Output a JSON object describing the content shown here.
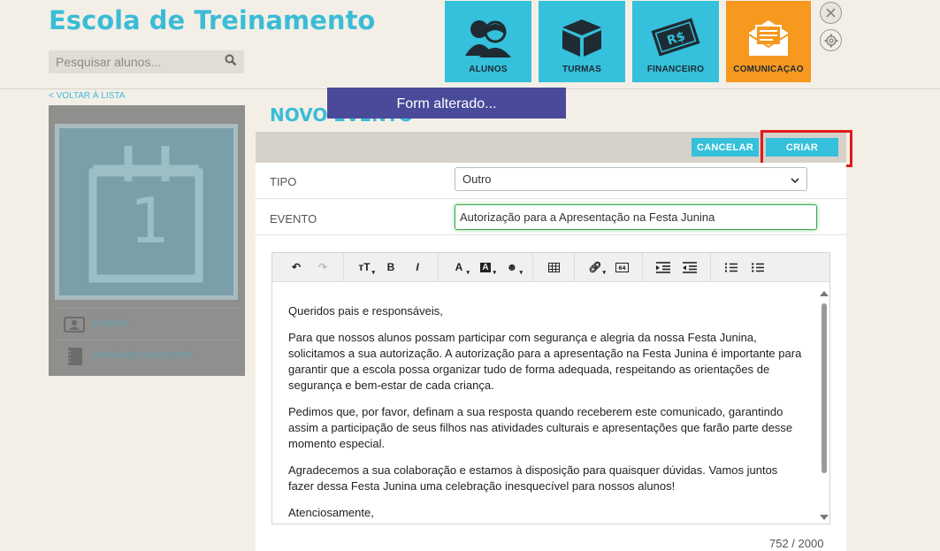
{
  "app": {
    "title": "Escola de Treinamento"
  },
  "search": {
    "placeholder": "Pesquisar alunos..."
  },
  "nav": {
    "tiles": [
      {
        "label": "ALUNOS",
        "icon": "students-icon"
      },
      {
        "label": "TURMAS",
        "icon": "box-icon"
      },
      {
        "label": "FINANCEIRO",
        "icon": "money-icon"
      },
      {
        "label": "COMUNICAÇAO",
        "icon": "envelope-icon"
      }
    ],
    "active": "COMUNICAÇAO"
  },
  "sidebar": {
    "back_label": "< VOLTAR À LISTA",
    "calendar_number": "1",
    "items": [
      {
        "label": "EVENTO",
        "icon": "id-card-icon"
      },
      {
        "label": "DETALHES DO EVENTO",
        "icon": "notebook-icon"
      }
    ]
  },
  "page": {
    "heading": "NOVO EVENTO"
  },
  "toast": {
    "message": "Form alterado..."
  },
  "actions": {
    "cancel_label": "CANCELAR",
    "create_label": "CRIAR"
  },
  "form": {
    "tipo_label": "TIPO",
    "tipo_value": "Outro",
    "evento_label": "EVENTO",
    "evento_value": "Autorização para a Apresentação na Festa Junina"
  },
  "editor": {
    "paragraphs": [
      "Queridos pais e responsáveis,",
      "Para que nossos alunos possam participar com segurança e alegria da nossa Festa Junina, solicitamos a sua autorização. A autorização para a apresentação na Festa Junina é importante para garantir que a escola possa organizar tudo de forma adequada, respeitando as orientações de segurança e bem-estar de cada criança.",
      "Pedimos que, por favor, definam a sua resposta quando receberem este comunicado, garantindo assim a participação de seus filhos nas atividades culturais e apresentações que farão parte desse momento especial.",
      "Agradecemos a sua colaboração e estamos à disposição para quaisquer dúvidas. Vamos juntos fazer dessa Festa Junina uma celebração inesquecível para nossos alunos!",
      "Atenciosamente,"
    ],
    "counter": "752 / 2000",
    "toolbar_emoji_icon": "smiley-icon"
  },
  "colors": {
    "accent": "#35c0db",
    "active": "#f7981f",
    "toast": "#4a4a9b",
    "highlight": "#e01a1a"
  }
}
